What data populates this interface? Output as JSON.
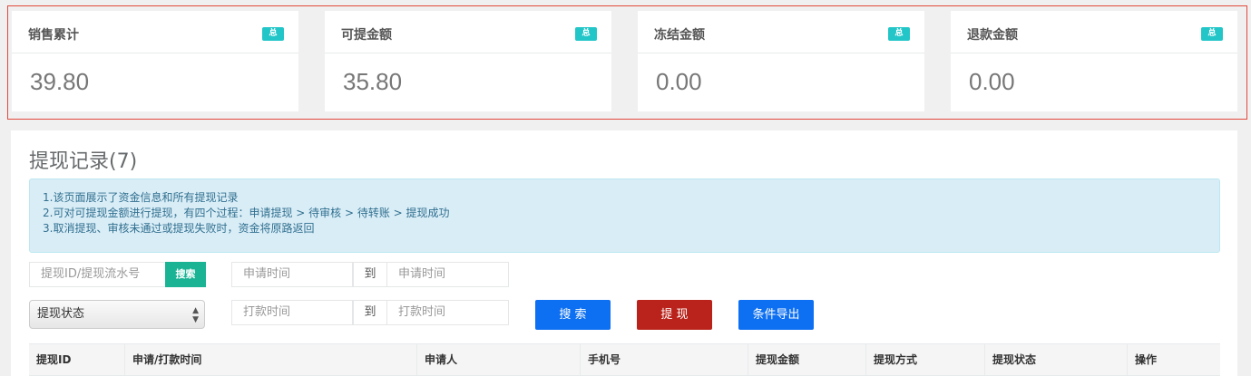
{
  "stats": [
    {
      "title": "销售累计",
      "badge": "总",
      "value": "39.80"
    },
    {
      "title": "可提金额",
      "badge": "总",
      "value": "35.80"
    },
    {
      "title": "冻结金额",
      "badge": "总",
      "value": "0.00"
    },
    {
      "title": "退款金额",
      "badge": "总",
      "value": "0.00"
    }
  ],
  "panel": {
    "title": "提现记录(7)",
    "info": [
      "1.该页面展示了资金信息和所有提现记录",
      "2.可对可提现金额进行提现，有四个过程：申请提现 > 待审核 > 待转账 > 提现成功",
      "3.取消提现、审核未通过或提现失败时，资金将原路返回"
    ]
  },
  "filters": {
    "id_placeholder": "提现ID/提现流水号",
    "search_mini": "搜索",
    "apply_start": "申请时间",
    "to1": "到",
    "apply_end": "申请时间",
    "status_select": "提现状态",
    "pay_start": "打款时间",
    "to2": "到",
    "pay_end": "打款时间",
    "search_btn": "搜 索",
    "withdraw_btn": "提 现",
    "export_btn": "条件导出"
  },
  "table": {
    "columns": [
      "提现ID",
      "申请/打款时间",
      "申请人",
      "手机号",
      "提现金额",
      "提现方式",
      "提现状态",
      "操作"
    ]
  },
  "colors": {
    "accent_teal": "#23c6c8",
    "green": "#1ab394",
    "blue": "#0d6ff2",
    "red": "#b9231b",
    "highlight": "#e2493c"
  }
}
